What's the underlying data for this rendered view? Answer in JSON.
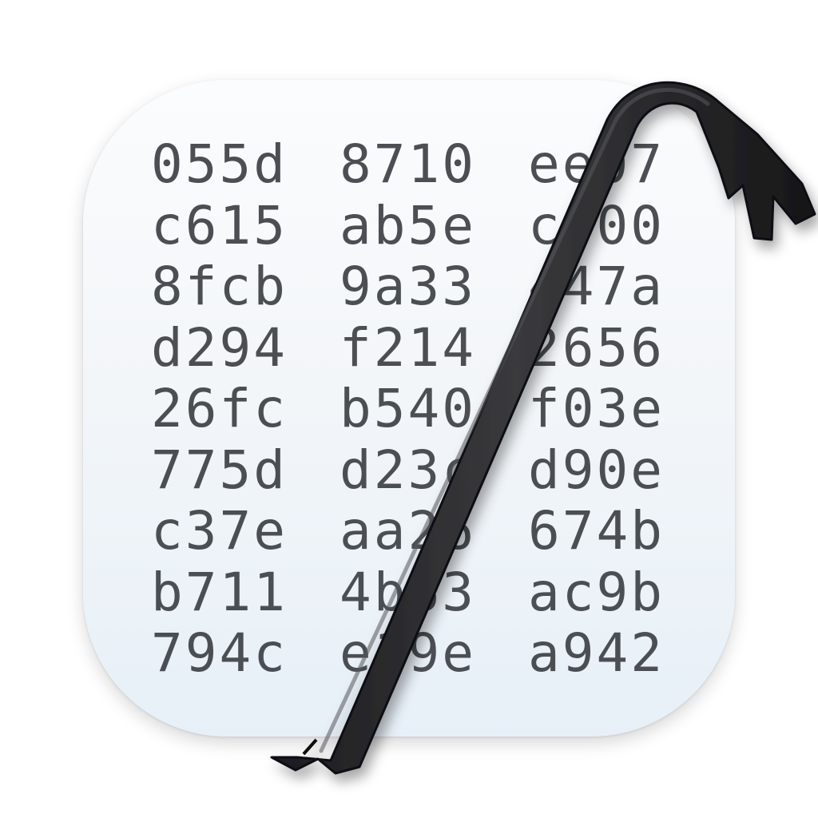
{
  "hex_rows": [
    [
      "055d",
      "8710",
      "ee07"
    ],
    [
      "c615",
      "ab5e",
      "c900"
    ],
    [
      "8fcb",
      "9a33",
      "447a"
    ],
    [
      "d294",
      "f214",
      "2656"
    ],
    [
      "26fc",
      "b540",
      "f03e"
    ],
    [
      "775d",
      "d23c",
      "d90e"
    ],
    [
      "c37e",
      "aa26",
      "674b"
    ],
    [
      "b711",
      "4b63",
      "ac9b"
    ],
    [
      "794c",
      "e19e",
      "a942"
    ]
  ],
  "colors": {
    "text": "#4b4f53",
    "crowbar": "#2b2b2d",
    "tile_top": "#fbfcfd",
    "tile_bottom": "#e7f0f8"
  },
  "icons": {
    "tool": "crowbar-icon"
  }
}
